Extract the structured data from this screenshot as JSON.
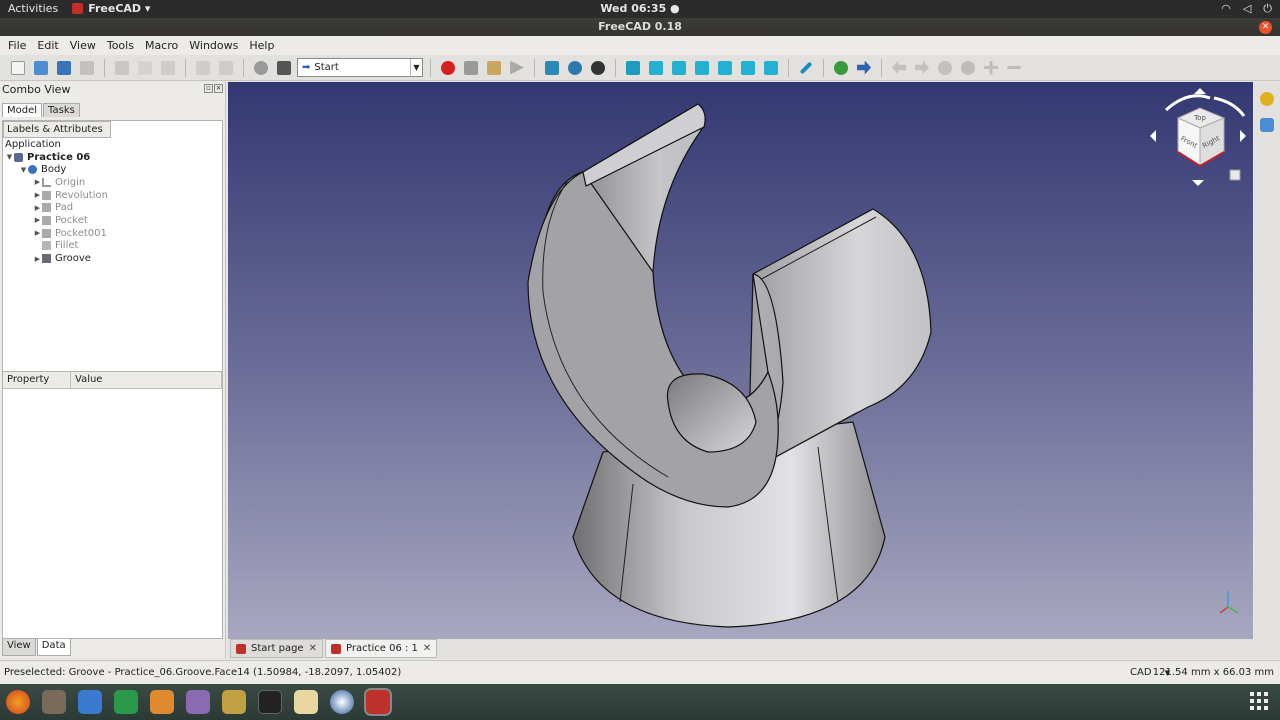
{
  "topbar": {
    "activities": "Activities",
    "app_name": "FreeCAD ▾",
    "clock": "Wed 06:35 ●",
    "tray": [
      "wifi-icon",
      "volume-icon",
      "power-icon"
    ]
  },
  "window": {
    "title": "FreeCAD 0.18"
  },
  "menu": [
    "File",
    "Edit",
    "View",
    "Tools",
    "Macro",
    "Windows",
    "Help"
  ],
  "toolbar": {
    "workbench": "Start",
    "icons": [
      "new-icon",
      "open-icon",
      "save-icon",
      "print-icon",
      "cut-icon",
      "copy-icon",
      "paste-icon",
      "undo-icon",
      "redo-icon",
      "refresh-icon",
      "whats-this-icon",
      "macro-record-icon",
      "macro-stop-icon",
      "macro-edit-icon",
      "macro-run-icon",
      "fit-all-icon",
      "fit-selection-icon",
      "draw-style-icon",
      "isometric-icon",
      "front-view-icon",
      "top-view-icon",
      "right-view-icon",
      "rear-view-icon",
      "bottom-view-icon",
      "left-view-icon",
      "measure-icon",
      "web-icon",
      "forward-icon",
      "back-icon",
      "next-icon",
      "reload-icon",
      "stop-icon",
      "zoom-in-icon",
      "zoom-out-icon"
    ]
  },
  "combo": {
    "title": "Combo View",
    "tabs": [
      "Model",
      "Tasks"
    ],
    "column_header": "Labels & Attributes",
    "tree": {
      "root": "Application",
      "document": "Practice 06",
      "body": "Body",
      "features": [
        "Origin",
        "Revolution",
        "Pad",
        "Pocket",
        "Pocket001",
        "Fillet",
        "Groove"
      ]
    },
    "property_headers": [
      "Property",
      "Value"
    ],
    "bottom_tabs": [
      "View",
      "Data"
    ]
  },
  "navcube": {
    "faces": [
      "Top",
      "Front",
      "Right"
    ]
  },
  "doc_tabs": [
    "Start page",
    "Practice 06 : 1"
  ],
  "status": {
    "message": "Preselected: Groove - Practice_06.Groove.Face14 (1.50984, -18.2097, 1.05402)",
    "nav_style": "CAD",
    "dimensions": "121.54 mm x 66.03 mm"
  },
  "colors": {
    "viewport_top": "#343872",
    "viewport_bottom": "#a8a7c0",
    "macro_record": "#d42020"
  }
}
